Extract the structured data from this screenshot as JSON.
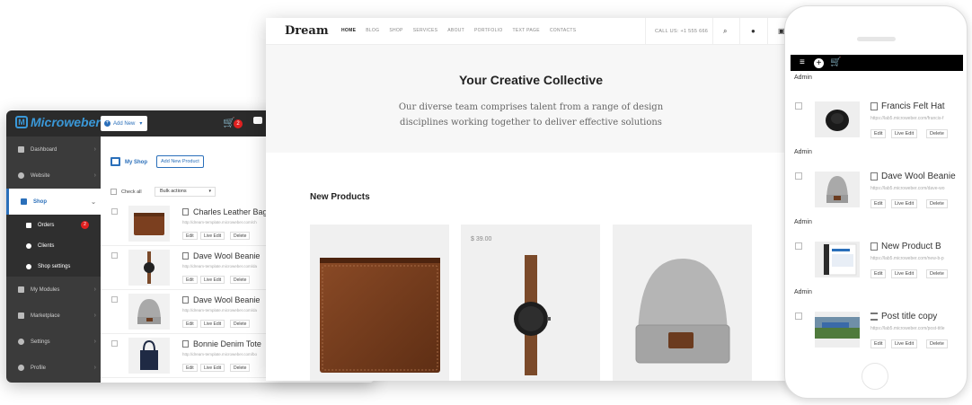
{
  "admin": {
    "logo": "Microweber",
    "add_new": "Add New",
    "cart_count": "2",
    "sidebar": {
      "items": [
        {
          "label": "Dashboard",
          "icon": "grid-icon"
        },
        {
          "label": "Website",
          "icon": "globe-icon"
        },
        {
          "label": "Shop",
          "icon": "shop-icon"
        },
        {
          "label": "My Modules",
          "icon": "modules-icon"
        },
        {
          "label": "Marketplace",
          "icon": "puzzle-icon"
        },
        {
          "label": "Settings",
          "icon": "gear-icon"
        },
        {
          "label": "Profile",
          "icon": "user-icon"
        }
      ],
      "sub_items": [
        {
          "label": "Orders",
          "badge": "2"
        },
        {
          "label": "Clients"
        },
        {
          "label": "Shop settings"
        }
      ]
    },
    "my_shop": "My Shop",
    "add_new_product": "Add New Product",
    "check_all": "Check all",
    "bulk_actions": "Bulk actions",
    "products": [
      {
        "title": "Charles Leather Bag",
        "url": "http://dream-template.microweber.com/ch"
      },
      {
        "title": "Dave Wool Beanie",
        "url": "http://dream-template.microweber.com/da"
      },
      {
        "title": "Dave Wool Beanie",
        "url": "http://dream-template.microweber.com/da"
      },
      {
        "title": "Bonnie Denim Tote",
        "url": "http://dream-template.microweber.com/bo"
      }
    ],
    "actions": {
      "edit": "Edit",
      "live_edit": "Live Edit",
      "delete": "Delete"
    }
  },
  "site": {
    "brand": "Dream",
    "menu": [
      "HOME",
      "BLOG",
      "SHOP",
      "SERVICES",
      "ABOUT",
      "PORTFOLIO",
      "TEXT PAGE",
      "CONTACTS"
    ],
    "call": "CALL US: +1 555 666",
    "hero_title": "Your Creative Collective",
    "hero_text": "Our diverse team comprises talent from a range of design disciplines working together to deliver effective solutions",
    "new_products": "New Products",
    "cards": [
      {
        "price": "",
        "image": "wallet"
      },
      {
        "price": "$ 39.00",
        "image": "watch"
      },
      {
        "price": "",
        "image": "beanie"
      }
    ]
  },
  "phone": {
    "admin_label": "Admin",
    "rows": [
      {
        "title": "Francis Felt Hat",
        "url": "https://lab5.microweber.com/francis-f"
      },
      {
        "title": "Dave Wool Beanie",
        "url": "https://lab5.microweber.com/dave-wo"
      },
      {
        "title": "New Product B",
        "url": "https://lab5.microweber.com/new-b-p"
      },
      {
        "title": "Post title copy",
        "url": "https://lab5.microweber.com/post-title"
      }
    ],
    "actions": {
      "edit": "Edit",
      "live_edit": "Live Edit",
      "delete": "Delete"
    }
  }
}
